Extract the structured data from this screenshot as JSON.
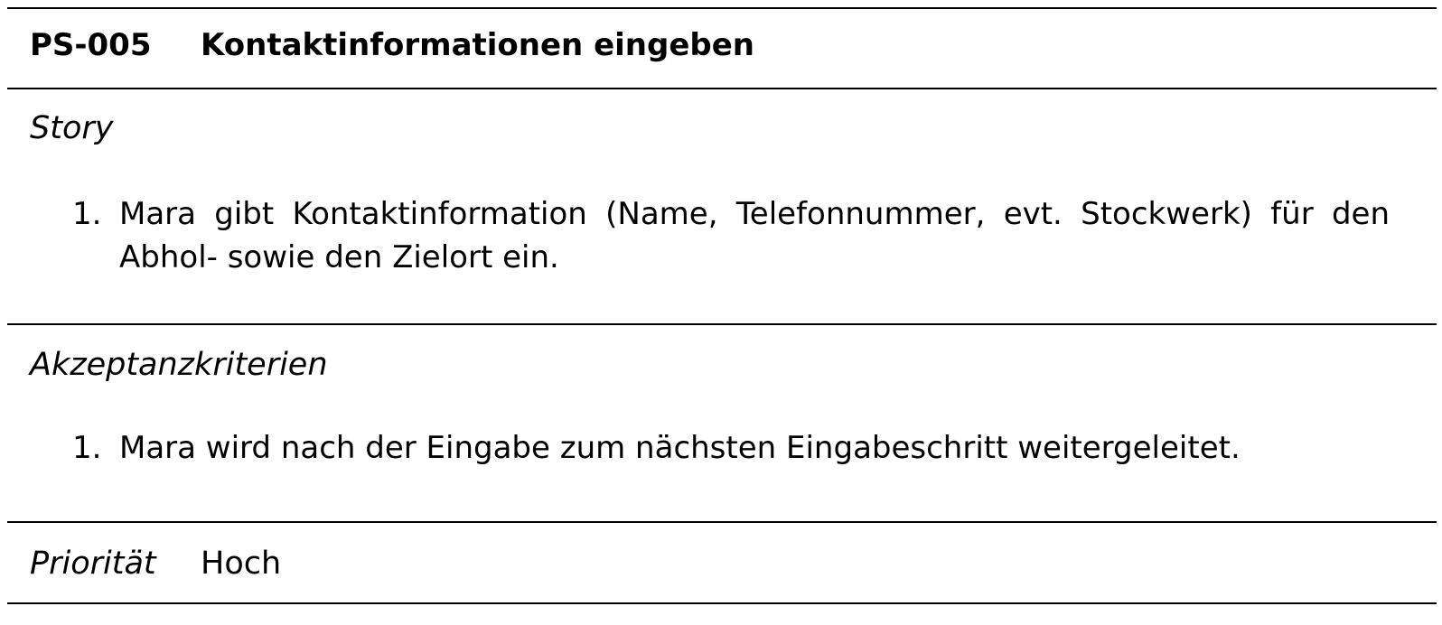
{
  "header": {
    "id": "PS-005",
    "title": "Kontaktinformationen eingeben"
  },
  "story": {
    "heading": "Story",
    "items": [
      {
        "number": "1.",
        "text": "Mara gibt Kontaktinformation (Name, Telefonnummer, evt. Stockwerk) für den Abhol- sowie den Zielort ein."
      }
    ]
  },
  "acceptance": {
    "heading": "Akzeptanzkriterien",
    "items": [
      {
        "number": "1.",
        "text": "Mara wird nach der Eingabe zum nächsten Eingabeschritt weitergeleitet."
      }
    ]
  },
  "priority": {
    "label": "Priorität",
    "value": "Hoch"
  }
}
